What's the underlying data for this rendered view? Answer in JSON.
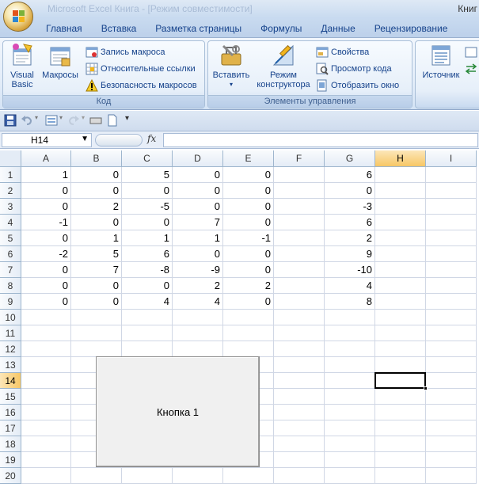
{
  "window": {
    "title": "Книг",
    "faint_title": "Microsoft Excel Книга - [Режим совместимости]"
  },
  "tabs": [
    "Главная",
    "Вставка",
    "Разметка страницы",
    "Формулы",
    "Данные",
    "Рецензирование"
  ],
  "ribbon": {
    "code_group": {
      "label": "Код",
      "visual_basic_line1": "Visual",
      "visual_basic_line2": "Basic",
      "macros": "Макросы",
      "record_macro": "Запись макроса",
      "relative_refs": "Относительные ссылки",
      "macro_security": "Безопасность макросов"
    },
    "controls_group": {
      "label": "Элементы управления",
      "insert": "Вставить",
      "design_mode_line1": "Режим",
      "design_mode_line2": "конструктора",
      "properties": "Свойства",
      "view_code": "Просмотр кода",
      "run_dialog": "Отобразить окно"
    },
    "xml_group": {
      "source": "Источник"
    }
  },
  "formula_bar": {
    "name_box": "H14",
    "fx": "fx",
    "formula": ""
  },
  "grid": {
    "columns": [
      "A",
      "B",
      "C",
      "D",
      "E",
      "F",
      "G",
      "H",
      "I"
    ],
    "selected_column": "H",
    "selected_row": "14",
    "rows": [
      {
        "n": "1",
        "cells": [
          "1",
          "0",
          "5",
          "0",
          "0",
          "",
          "6"
        ]
      },
      {
        "n": "2",
        "cells": [
          "0",
          "0",
          "0",
          "0",
          "0",
          "",
          "0"
        ]
      },
      {
        "n": "3",
        "cells": [
          "0",
          "2",
          "-5",
          "0",
          "0",
          "",
          "-3"
        ]
      },
      {
        "n": "4",
        "cells": [
          "-1",
          "0",
          "0",
          "7",
          "0",
          "",
          "6"
        ]
      },
      {
        "n": "5",
        "cells": [
          "0",
          "1",
          "1",
          "1",
          "-1",
          "",
          "2"
        ]
      },
      {
        "n": "6",
        "cells": [
          "-2",
          "5",
          "6",
          "0",
          "0",
          "",
          "9"
        ]
      },
      {
        "n": "7",
        "cells": [
          "0",
          "7",
          "-8",
          "-9",
          "0",
          "",
          "-10"
        ]
      },
      {
        "n": "8",
        "cells": [
          "0",
          "0",
          "0",
          "2",
          "2",
          "",
          "4"
        ]
      },
      {
        "n": "9",
        "cells": [
          "0",
          "0",
          "4",
          "4",
          "0",
          "",
          "8"
        ]
      },
      {
        "n": "10",
        "cells": []
      },
      {
        "n": "11",
        "cells": []
      },
      {
        "n": "12",
        "cells": []
      },
      {
        "n": "13",
        "cells": []
      },
      {
        "n": "14",
        "cells": []
      },
      {
        "n": "15",
        "cells": []
      },
      {
        "n": "16",
        "cells": []
      },
      {
        "n": "17",
        "cells": []
      },
      {
        "n": "18",
        "cells": []
      },
      {
        "n": "19",
        "cells": []
      },
      {
        "n": "20",
        "cells": []
      }
    ]
  },
  "form_button": {
    "label": "Кнопка 1"
  },
  "colors": {
    "selected_header": "#f7c766",
    "gridline": "#d0d7e5"
  }
}
